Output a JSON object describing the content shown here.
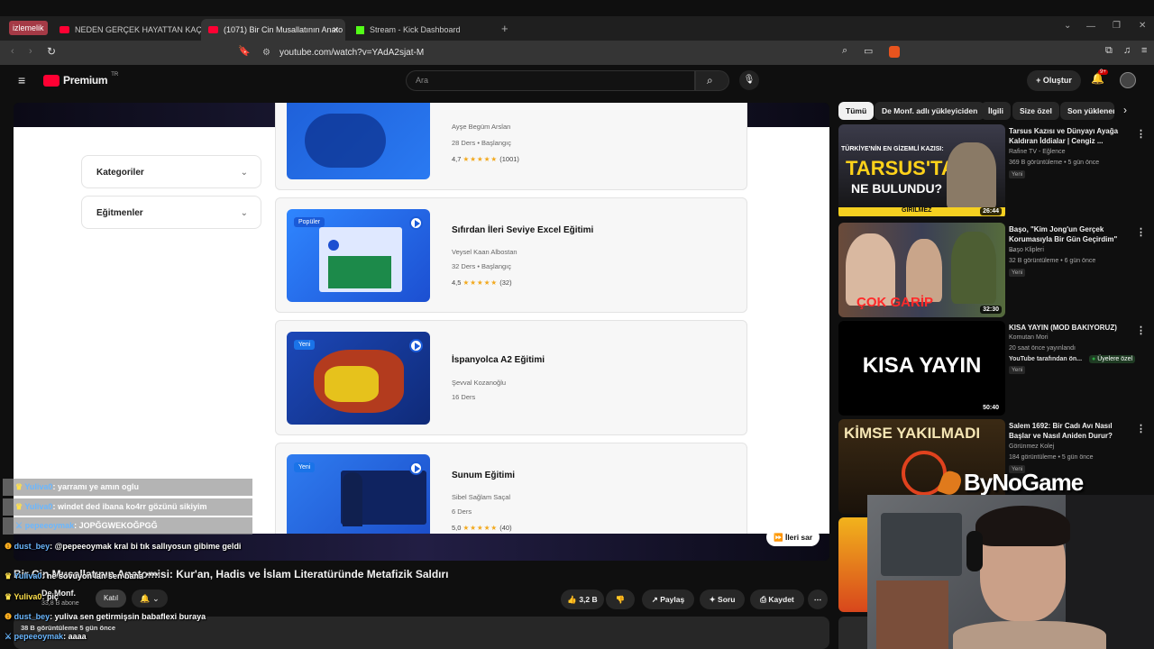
{
  "browser": {
    "tab_group_label": "izlemelik",
    "tabs": [
      {
        "label": "NEDEN GERÇEK HAYATTAN KAÇMAK"
      },
      {
        "label": "(1071) Bir Cin Musallatının Anato"
      },
      {
        "label": "Stream - Kick Dashboard"
      }
    ],
    "url": "youtube.com/watch?v=YAdA2sjat-M"
  },
  "youtube": {
    "logo": "Premium",
    "logo_region": "TR",
    "search_placeholder": "Ara",
    "create_label": "Oluştur",
    "notif_count": "9+"
  },
  "course_page": {
    "filters": [
      {
        "label": "Kategoriler"
      },
      {
        "label": "Eğitmenler"
      }
    ],
    "courses": [
      {
        "title": "",
        "instructor": "Ayşe Begüm Arslan",
        "meta": "28 Ders  •  Başlangıç",
        "rating": "4,7",
        "count": "(1001)",
        "badge": "",
        "stars": "★★★★★"
      },
      {
        "title": "Sıfırdan İleri Seviye Excel Eğitimi",
        "instructor": "Veysel Kaan Albostan",
        "meta": "32 Ders  •  Başlangıç",
        "rating": "4,5",
        "count": "(32)",
        "badge": "Popüler",
        "stars": "★★★★★"
      },
      {
        "title": "İspanyolca A2 Eğitimi",
        "instructor": "Şevval Kozanoğlu",
        "meta": "16 Ders",
        "rating": "",
        "count": "",
        "badge": "Yeni",
        "stars": ""
      },
      {
        "title": "Sunum Eğitimi",
        "instructor": "Sibel Sağlam Saçal",
        "meta": "6 Ders",
        "rating": "5,0",
        "count": "(40)",
        "badge": "Yeni",
        "stars": "★★★★★"
      }
    ],
    "skip_label": "İleri sar"
  },
  "video": {
    "title": "Bir Cin Musallatının Anatomisi: Kur'an, Hadis ve İslam Literatüründe Metafizik Saldırı",
    "channel": "De Monf.",
    "subs": "33,8 B abone",
    "join_label": "Katıl",
    "likes": "3,2 B",
    "share_label": "Paylaş",
    "ask_label": "Soru",
    "save_label": "Kaydet",
    "views": "38 B görüntüleme  5 gün önce"
  },
  "sidebar": {
    "chips": [
      "Tümü",
      "De Monf. adlı yükleyiciden",
      "İlgili",
      "Size özel",
      "Son yüklenen"
    ],
    "recommendations": [
      {
        "title": "Tarsus Kazısı ve Dünyayı Ayağa Kaldıran İddialar | Cengiz ...",
        "channel": "Rafine TV - Eğlence",
        "stats": "369 B görüntüleme  •  5 gün önce",
        "new": "Yeni",
        "duration": "26:44",
        "thumb_text1": "TÜRKİYE'NİN EN GİZEMLİ KAZISI:",
        "thumb_text2": "TARSUS'TA",
        "thumb_text3": "NE BULUNDU?",
        "thumb_text4": "GİRİLMEZ"
      },
      {
        "title": "Başo, \"Kim Jong'un Gerçek Korumasıyla Bir Gün Geçirdim\" ...",
        "channel": "Başo Klipleri",
        "stats": "32 B görüntüleme  •  6 gün önce",
        "new": "Yeni",
        "duration": "32:30",
        "thumb_text1": "ÇOK GARİP"
      },
      {
        "title": "KISA YAYIN (MOD BAKIYORUZ)",
        "channel": "Komutan Mori",
        "stats": "20 saat önce yayınlandı",
        "extra": "YouTube tarafından ön...",
        "members": "Üyelere özel",
        "new": "Yeni",
        "duration": "50:40",
        "thumb_text1": "KISA YAYIN"
      },
      {
        "title": "Salem 1692: Bir Cadı Avı Nasıl Başlar ve Nasıl Aniden Durur?",
        "channel": "Görünmez Kolej",
        "stats": "184 görüntüleme  •  5 gün önce",
        "new": "Yeni",
        "thumb_text1": "KİMSE YAKILMADI"
      }
    ]
  },
  "overlay": {
    "watermark": "ByNoGame"
  },
  "chat": {
    "messages": [
      {
        "user": "Yuliva0",
        "text": "yarramı ye amın oglu"
      },
      {
        "user": "Yuliva0",
        "text": "windet ded ibana ko4rr gözünü sikiyim"
      },
      {
        "user": "pepeeoymak",
        "text": "JOPĞGWEKOĞPGĞ"
      },
      {
        "user": "dust_bey",
        "text": "@pepeeoymak kral bi tık sallıyosun gibime geldi"
      },
      {
        "user": "Yuliva0",
        "text": "ne sövüyon lan sen bana ****"
      },
      {
        "user": "Yuliva0",
        "text": "piç"
      },
      {
        "user": "dust_bey",
        "text": "yuliva sen getirmişsin babaflexi buraya"
      },
      {
        "user": "pepeeoymak",
        "text": "aaaa"
      }
    ]
  },
  "colors": {
    "yt_red": "#ff0033",
    "accent_blue": "#1a73e8",
    "star": "#f2a91e",
    "members_green": "#2ba640"
  }
}
